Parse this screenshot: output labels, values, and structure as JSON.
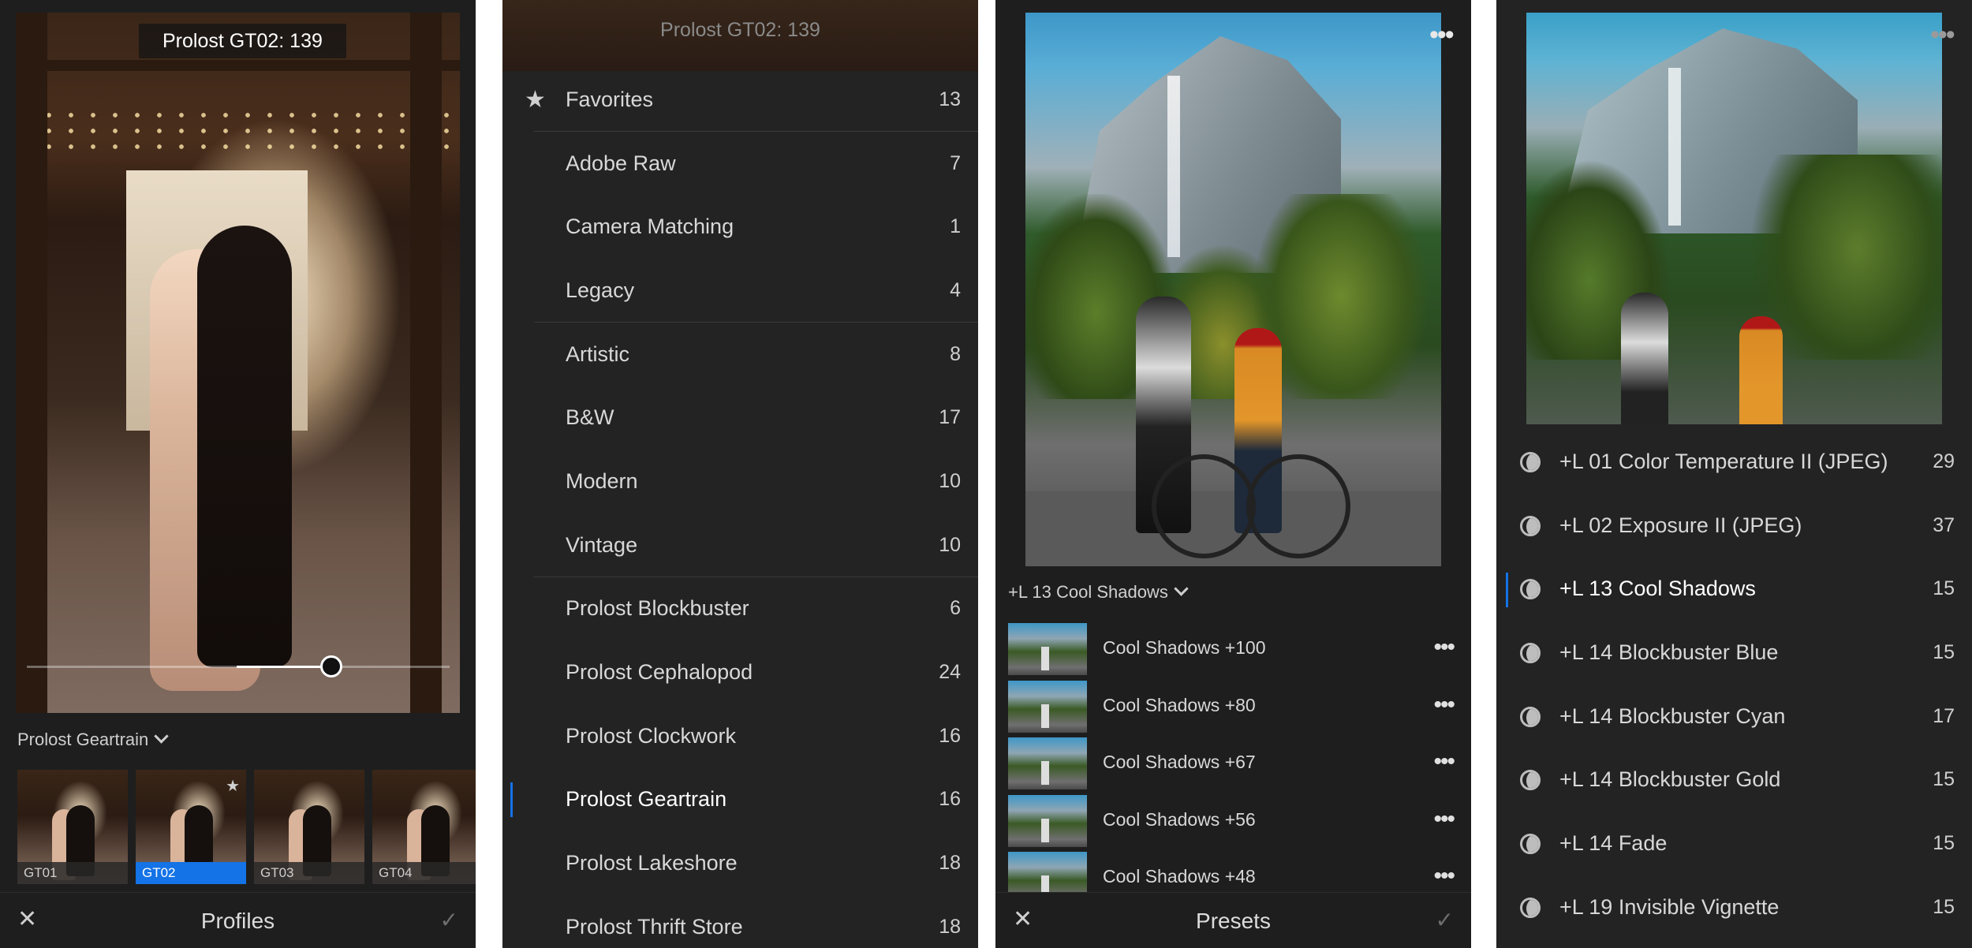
{
  "panel1": {
    "overlay_title": "Prolost GT02: 139",
    "slider_value_fraction": 0.72,
    "group_label": "Prolost Geartrain",
    "thumbnails": [
      {
        "label": "GT01",
        "selected": false,
        "starred": false
      },
      {
        "label": "GT02",
        "selected": true,
        "starred": true
      },
      {
        "label": "GT03",
        "selected": false,
        "starred": false
      },
      {
        "label": "GT04",
        "selected": false,
        "starred": false
      }
    ],
    "bottom_title": "Profiles",
    "close_glyph": "✕",
    "check_glyph": "✓"
  },
  "panel2": {
    "header_title": "Prolost GT02: 139",
    "items": [
      {
        "label": "Favorites",
        "count": "13",
        "icon": "star-icon",
        "sep": true
      },
      {
        "label": "Adobe Raw",
        "count": "7",
        "sep": false
      },
      {
        "label": "Camera Matching",
        "count": "1",
        "sep": false
      },
      {
        "label": "Legacy",
        "count": "4",
        "sep": true
      },
      {
        "label": "Artistic",
        "count": "8",
        "sep": false
      },
      {
        "label": "B&W",
        "count": "17",
        "sep": false
      },
      {
        "label": "Modern",
        "count": "10",
        "sep": false
      },
      {
        "label": "Vintage",
        "count": "10",
        "sep": true
      },
      {
        "label": "Prolost Blockbuster",
        "count": "6",
        "sep": false
      },
      {
        "label": "Prolost Cephalopod",
        "count": "24",
        "sep": false
      },
      {
        "label": "Prolost Clockwork",
        "count": "16",
        "sep": false
      },
      {
        "label": "Prolost Geartrain",
        "count": "16",
        "sep": false,
        "active": true
      },
      {
        "label": "Prolost Lakeshore",
        "count": "18",
        "sep": false
      },
      {
        "label": "Prolost Thrift Store",
        "count": "18",
        "sep": false
      }
    ]
  },
  "panel3": {
    "preset_group": "+L 13 Cool Shadows",
    "presets": [
      {
        "label": "Cool Shadows +100"
      },
      {
        "label": "Cool Shadows +80"
      },
      {
        "label": "Cool Shadows +67"
      },
      {
        "label": "Cool Shadows +56"
      },
      {
        "label": "Cool Shadows +48"
      }
    ],
    "bottom_title": "Presets",
    "close_glyph": "✕",
    "check_glyph": "✓"
  },
  "panel4": {
    "items": [
      {
        "label": "+L 01 Color Temperature II (JPEG)",
        "count": "29"
      },
      {
        "label": "+L 02 Exposure II (JPEG)",
        "count": "37"
      },
      {
        "label": "+L 13 Cool Shadows",
        "count": "15",
        "active": true
      },
      {
        "label": "+L 14 Blockbuster Blue",
        "count": "15"
      },
      {
        "label": "+L 14 Blockbuster Cyan",
        "count": "17"
      },
      {
        "label": "+L 14 Blockbuster Gold",
        "count": "15"
      },
      {
        "label": "+L 14 Fade",
        "count": "15"
      },
      {
        "label": "+L 19 Invisible Vignette",
        "count": "15"
      }
    ]
  },
  "colors": {
    "accent": "#1473e6",
    "panel_bg": "#1e1e1e"
  }
}
